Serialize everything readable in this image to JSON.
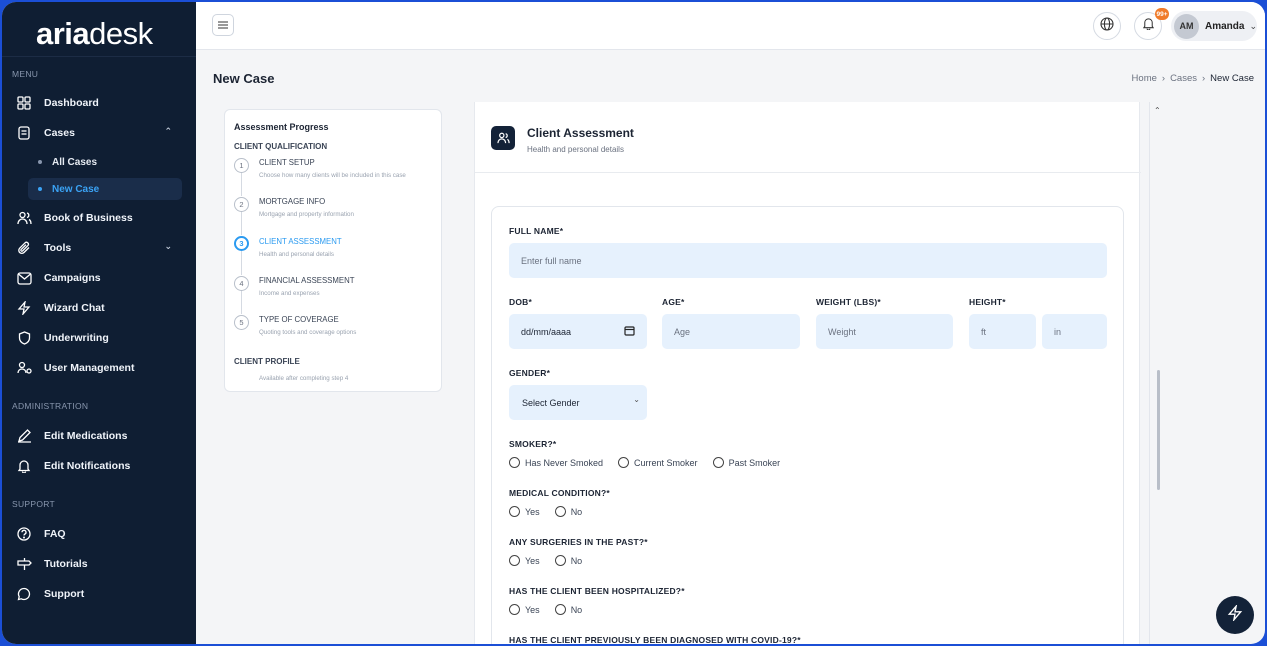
{
  "app": {
    "logo_bold": "aria",
    "logo_thin": "desk"
  },
  "sidebar": {
    "menu_label": "MENU",
    "admin_label": "ADMINISTRATION",
    "support_label": "SUPPORT",
    "items": [
      {
        "label": "Dashboard",
        "icon": "grid-icon"
      },
      {
        "label": "Cases",
        "icon": "document-icon"
      },
      {
        "label": "Book of Business",
        "icon": "users-icon"
      },
      {
        "label": "Tools",
        "icon": "paperclip-icon"
      },
      {
        "label": "Campaigns",
        "icon": "mail-icon"
      },
      {
        "label": "Wizard Chat",
        "icon": "bolt-icon"
      },
      {
        "label": "Underwriting",
        "icon": "shield-icon"
      },
      {
        "label": "User Management",
        "icon": "user-manage-icon"
      }
    ],
    "sub_items": [
      {
        "label": "All Cases"
      },
      {
        "label": "New Case"
      }
    ],
    "admin_items": [
      {
        "label": "Edit Medications",
        "icon": "pen-icon"
      },
      {
        "label": "Edit Notifications",
        "icon": "bell-icon"
      }
    ],
    "support_items": [
      {
        "label": "FAQ",
        "icon": "question-icon"
      },
      {
        "label": "Tutorials",
        "icon": "signpost-icon"
      },
      {
        "label": "Support",
        "icon": "chat-icon"
      }
    ]
  },
  "topbar": {
    "notification_count": "99+",
    "user_initials": "AM",
    "user_name": "Amanda"
  },
  "page": {
    "title": "New Case",
    "breadcrumb": [
      "Home",
      "Cases",
      "New Case"
    ]
  },
  "progress": {
    "title": "Assessment Progress",
    "section1": "CLIENT QUALIFICATION",
    "steps": [
      {
        "num": "1",
        "title": "CLIENT SETUP",
        "desc": "Choose how many clients will be included in this case"
      },
      {
        "num": "2",
        "title": "MORTGAGE INFO",
        "desc": "Mortgage and property information"
      },
      {
        "num": "3",
        "title": "CLIENT ASSESSMENT",
        "desc": "Health and personal details"
      },
      {
        "num": "4",
        "title": "FINANCIAL ASSESSMENT",
        "desc": "Income and expenses"
      },
      {
        "num": "5",
        "title": "TYPE OF COVERAGE",
        "desc": "Quoting tools and coverage options"
      }
    ],
    "section2": "CLIENT PROFILE",
    "section2_note": "Available after completing step 4"
  },
  "form": {
    "title": "Client Assessment",
    "subtitle": "Health and personal details",
    "full_name_label": "FULL NAME*",
    "full_name_placeholder": "Enter full name",
    "dob_label": "DOB*",
    "dob_value": "dd/mm/aaaa",
    "age_label": "AGE*",
    "age_placeholder": "Age",
    "weight_label": "WEIGHT (LBS)*",
    "weight_placeholder": "Weight",
    "height_label": "HEIGHT*",
    "height_ft": "ft",
    "height_in": "in",
    "gender_label": "GENDER*",
    "gender_value": "Select Gender",
    "smoker_label": "SMOKER?*",
    "smoker_options": [
      "Has Never Smoked",
      "Current Smoker",
      "Past Smoker"
    ],
    "medical_label": "MEDICAL CONDITION?*",
    "surgeries_label": "ANY SURGERIES IN THE PAST?*",
    "hospitalized_label": "HAS THE CLIENT BEEN HOSPITALIZED?*",
    "covid_label": "HAS THE CLIENT PREVIOUSLY BEEN DIAGNOSED WITH COVID-19?*",
    "yes": "Yes",
    "no": "No"
  }
}
